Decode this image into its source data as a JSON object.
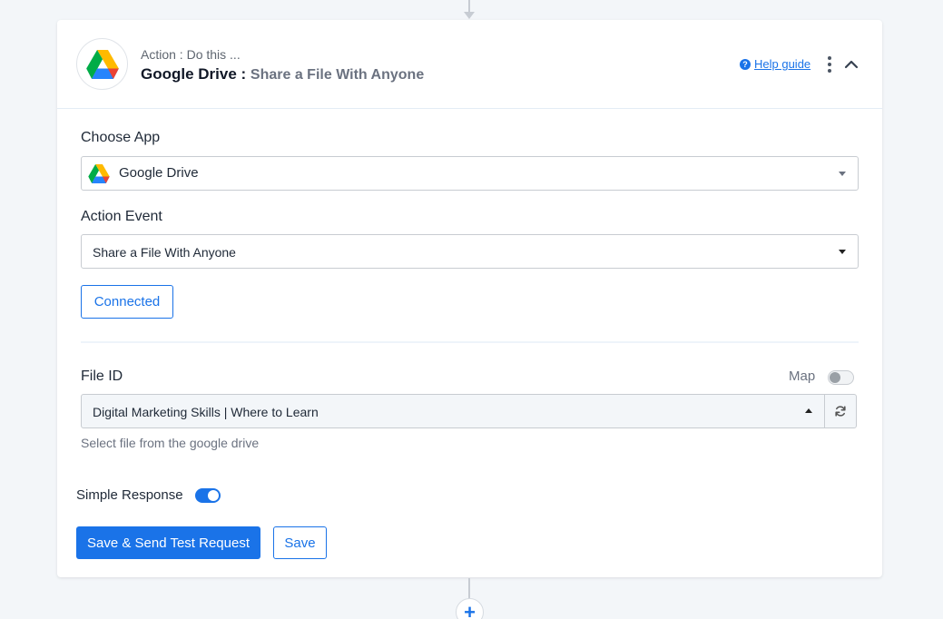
{
  "header": {
    "kicker": "Action : Do this ...",
    "app_name": "Google Drive :",
    "action_name": "Share a File With Anyone",
    "help_icon": "?",
    "help_label": "Help guide"
  },
  "form": {
    "choose_app_label": "Choose App",
    "choose_app_value": "Google Drive",
    "action_event_label": "Action Event",
    "action_event_value": "Share a File With Anyone",
    "connected_label": "Connected",
    "file_id_label": "File ID",
    "map_label": "Map",
    "map_enabled": false,
    "file_id_value": "Digital Marketing Skills | Where to Learn",
    "file_id_hint": "Select file from the google drive",
    "simple_response_label": "Simple Response",
    "simple_response_enabled": true
  },
  "actions": {
    "primary_label": "Save & Send Test Request",
    "save_label": "Save"
  },
  "add_step_symbol": "+",
  "icons": {
    "app_logo": "google-drive-icon",
    "help": "question-circle-icon",
    "menu": "kebab-menu-icon",
    "collapse": "chevron-up-icon",
    "dropdown": "caret-down-icon",
    "dropdown_open": "caret-up-icon",
    "refresh": "refresh-icon",
    "add": "plus-icon"
  },
  "colors": {
    "accent": "#1a73e8",
    "background": "#f3f6f9",
    "card": "#ffffff",
    "border": "#c8ccd1"
  }
}
